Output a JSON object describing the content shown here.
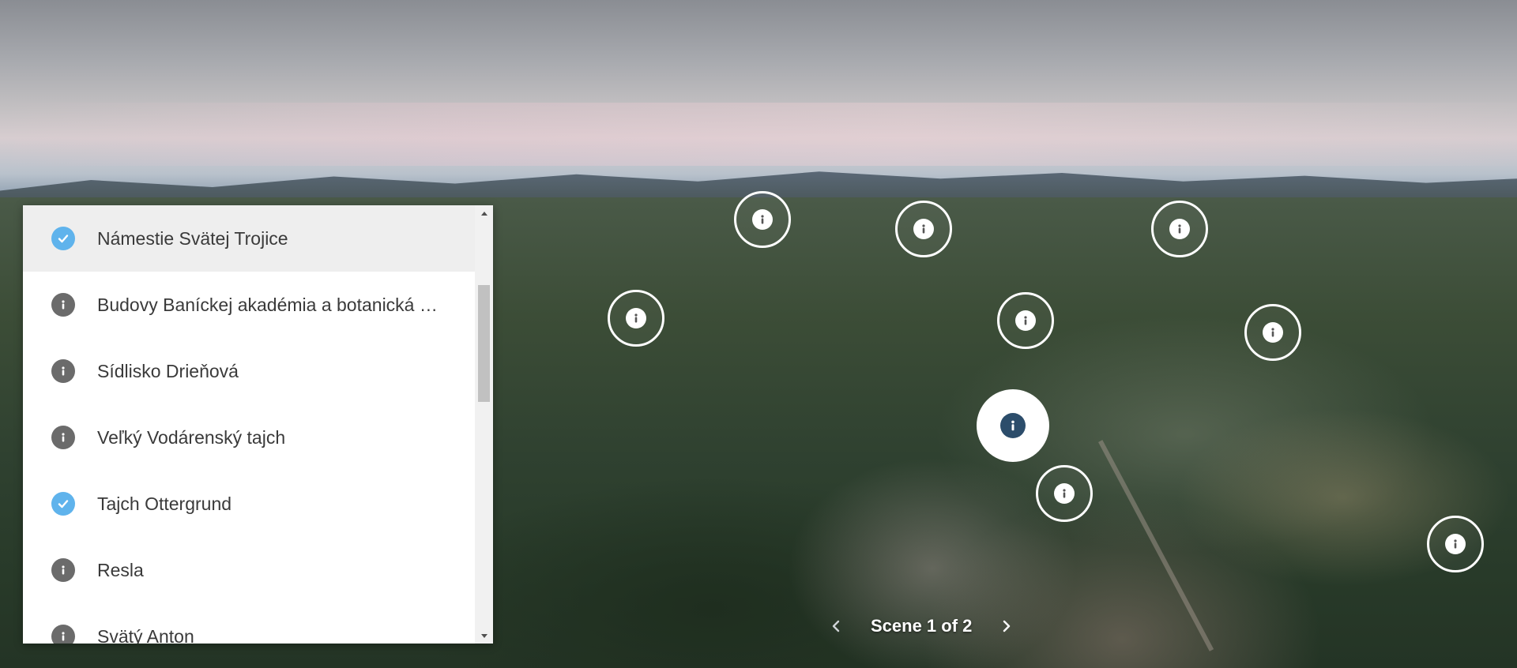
{
  "scene_list": {
    "items": [
      {
        "label": "Námestie Svätej Trojice",
        "status": "visited",
        "active": true
      },
      {
        "label": "Budovy Baníckej akadémia a botanická záhrada",
        "status": "info",
        "active": false
      },
      {
        "label": "Sídlisko Drieňová",
        "status": "info",
        "active": false
      },
      {
        "label": "Veľký Vodárenský tajch",
        "status": "info",
        "active": false
      },
      {
        "label": "Tajch Ottergrund",
        "status": "visited",
        "active": false
      },
      {
        "label": "Resla",
        "status": "info",
        "active": false
      },
      {
        "label": "Svätý Anton",
        "status": "info",
        "active": false
      }
    ],
    "scroll_position": 0.22
  },
  "scene_nav": {
    "counter": "Scene 1 of 2",
    "prev_icon": "chevron-left-icon",
    "next_icon": "chevron-right-icon"
  },
  "icons": {
    "visited": "check-circle-icon",
    "info": "info-icon"
  },
  "colors": {
    "visited": "#5fb3ec",
    "info": "#6b6b6b",
    "active_row": "#eeeeee",
    "selected_hotspot_dot": "#2c4d6b"
  }
}
